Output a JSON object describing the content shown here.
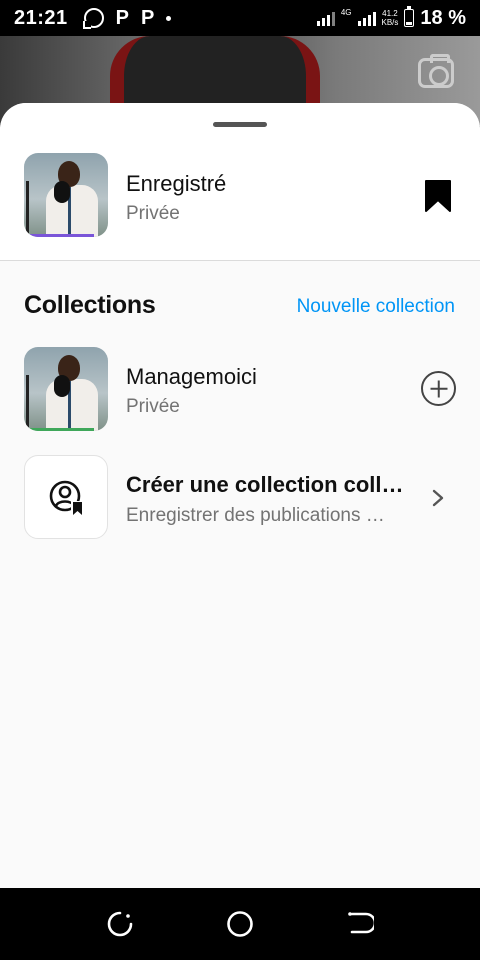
{
  "status_bar": {
    "time": "21:21",
    "app_icons": [
      "whatsapp-icon",
      "p-app-icon",
      "p-app-icon"
    ],
    "network": "4G",
    "speed_value": "41.2",
    "speed_unit": "KB/s",
    "battery": "18 %"
  },
  "sheet": {
    "saved": {
      "title": "Enregistré",
      "subtitle": "Privée",
      "icon": "bookmark-icon"
    },
    "collections": {
      "header": "Collections",
      "new_collection_label": "Nouvelle collection",
      "items": [
        {
          "title": "Managemoici",
          "subtitle": "Privée",
          "action_icon": "add-circle-icon"
        }
      ],
      "create": {
        "title": "Créer une collection coll…",
        "subtitle": "Enregistrer des publications …",
        "icon": "person-bookmark-icon"
      }
    }
  },
  "nav_bar": {
    "buttons": [
      "recent-apps-icon",
      "home-icon",
      "back-icon"
    ]
  },
  "colors": {
    "accent": "#0095f6",
    "sheet_bg": "#fafafa",
    "muted_text": "#737373"
  }
}
